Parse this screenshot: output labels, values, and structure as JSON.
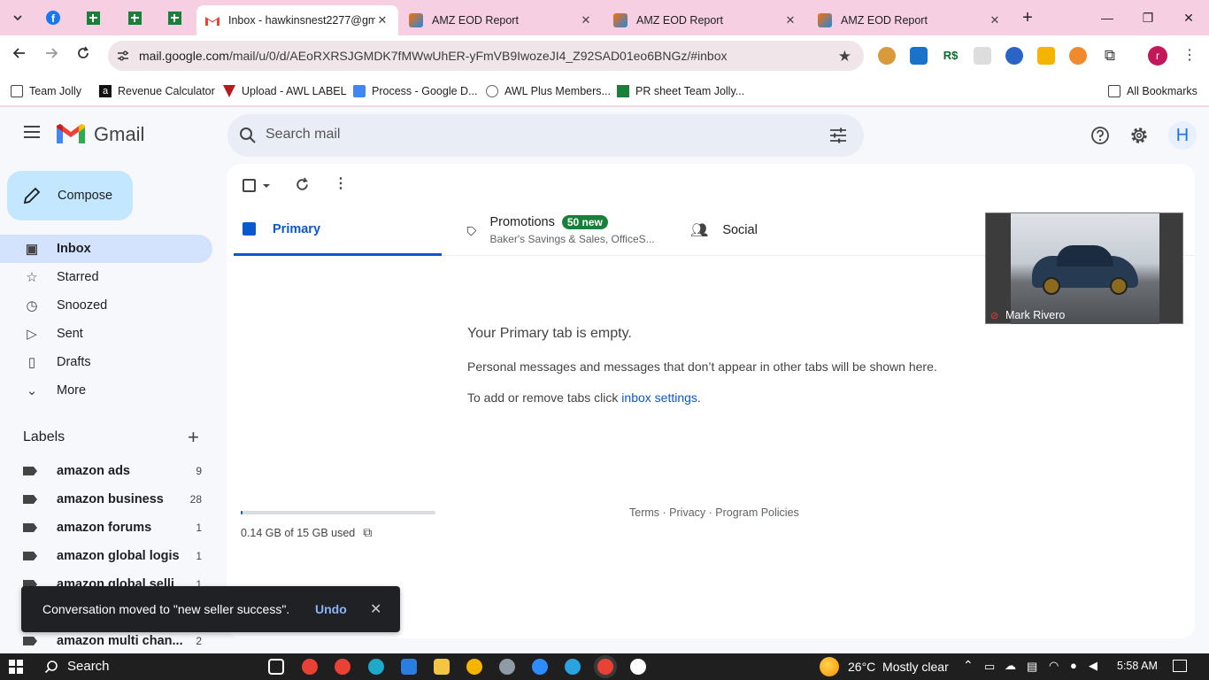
{
  "browser": {
    "tabs": [
      {
        "title": "Inbox - hawkinsnest2277@gm",
        "active": true
      },
      {
        "title": "AMZ EOD Report",
        "active": false
      },
      {
        "title": "AMZ EOD Report",
        "active": false
      },
      {
        "title": "AMZ EOD Report",
        "active": false
      }
    ],
    "url_host": "mail.google.com",
    "url_path": "/mail/u/0/d/AEoRXRSJGMDK7fMWwUhER-yFmVB9IwozeJI4_Z92SAD01eo6BNGz/#inbox",
    "profile_initial": "r",
    "bookmarks": [
      "Team Jolly",
      "Revenue Calculator",
      "Upload - AWL LABEL",
      "Process - Google D...",
      "AWL Plus Members...",
      "PR sheet Team Jolly..."
    ],
    "all_bookmarks": "All Bookmarks"
  },
  "gmail": {
    "logo_text": "Gmail",
    "search_placeholder": "Search mail",
    "account_initial": "H",
    "compose": "Compose",
    "nav": [
      {
        "label": "Inbox",
        "icon": "inbox-icon"
      },
      {
        "label": "Starred",
        "icon": "star-icon"
      },
      {
        "label": "Snoozed",
        "icon": "clock-icon"
      },
      {
        "label": "Sent",
        "icon": "send-icon"
      },
      {
        "label": "Drafts",
        "icon": "draft-icon"
      },
      {
        "label": "More",
        "icon": "chevron-down-icon"
      }
    ],
    "labels_heading": "Labels",
    "labels": [
      {
        "name": "amazon ads",
        "count": "9"
      },
      {
        "name": "amazon business",
        "count": "28"
      },
      {
        "name": "amazon forums",
        "count": "1"
      },
      {
        "name": "amazon global logis",
        "count": "1"
      },
      {
        "name": "amazon global selli",
        "count": "1"
      },
      {
        "name": "amazon multi chan...",
        "count": "2"
      }
    ],
    "tabs": {
      "primary": "Primary",
      "promotions": "Promotions",
      "promotions_badge": "50 new",
      "promotions_snippet": "Baker's Savings & Sales, OfficeS...",
      "social": "Social"
    },
    "empty": {
      "title": "Your Primary tab is empty.",
      "line1": "Personal messages and messages that don’t appear in other tabs will be shown here.",
      "line2_prefix": "To add or remove tabs click ",
      "line2_link": "inbox settings",
      "line2_suffix": "."
    },
    "storage": "0.14 GB of 15 GB used",
    "storage_fraction": 0.01,
    "footer": {
      "terms": "Terms",
      "sep": "·",
      "privacy": "Privacy",
      "policies": "Program Policies"
    },
    "toast": {
      "message": "Conversation moved to \"new seller success\".",
      "undo": "Undo"
    },
    "video": {
      "name": "Mark Rivero"
    }
  },
  "taskbar": {
    "search": "Search",
    "weather": "26°C  Mostly clear",
    "time": "5:58 AM"
  },
  "colors": {
    "accent": "#0b57d0",
    "badge": "#188038",
    "compose_bg": "#c2e7ff",
    "nav_active": "#d3e3fd"
  }
}
